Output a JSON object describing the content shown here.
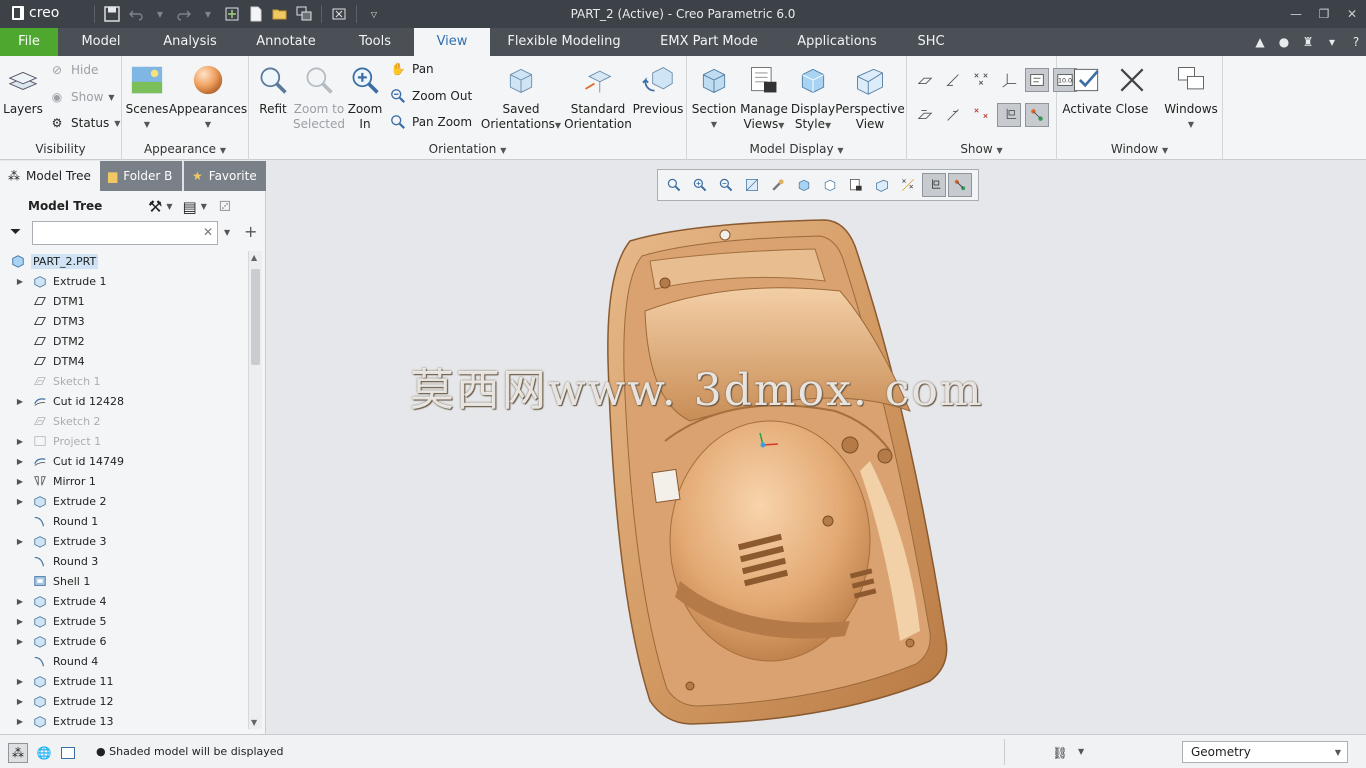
{
  "app": {
    "name": "creo",
    "window_title": "PART_2 (Active) - Creo Parametric 6.0"
  },
  "tabs": [
    "File",
    "Model",
    "Analysis",
    "Annotate",
    "Tools",
    "View",
    "Flexible Modeling",
    "EMX Part Mode",
    "Applications",
    "SHC"
  ],
  "ribbon": {
    "visibility": {
      "layers": "Layers",
      "hide": "Hide",
      "show": "Show",
      "status": "Status",
      "label": "Visibility"
    },
    "appearance": {
      "scenes": "Scenes",
      "appearances": "Appearances",
      "label": "Appearance"
    },
    "orientation": {
      "refit": "Refit",
      "zoom_selected_1": "Zoom to",
      "zoom_selected_2": "Selected",
      "zoom_in_1": "Zoom",
      "zoom_in_2": "In",
      "pan": "Pan",
      "zoom_out": "Zoom Out",
      "pan_zoom": "Pan Zoom",
      "saved_1": "Saved",
      "saved_2": "Orientations",
      "standard_1": "Standard",
      "standard_2": "Orientation",
      "previous": "Previous",
      "label": "Orientation"
    },
    "model_display": {
      "section": "Section",
      "manage_1": "Manage",
      "manage_2": "Views",
      "display_1": "Display",
      "display_2": "Style",
      "persp_1": "Perspective",
      "persp_2": "View",
      "label": "Model Display"
    },
    "show": {
      "label": "Show"
    },
    "window": {
      "activate": "Activate",
      "close": "Close",
      "windows": "Windows",
      "label": "Window"
    }
  },
  "sidebar": {
    "tabs": [
      "Model Tree",
      "Folder B",
      "Favorite"
    ],
    "header": "Model Tree",
    "tree": [
      {
        "label": "PART_2.PRT",
        "icon": "part-icon",
        "expandable": false,
        "suppressed": false,
        "selected": true
      },
      {
        "label": "Extrude 1",
        "icon": "extrude-icon",
        "expandable": true,
        "suppressed": false
      },
      {
        "label": "DTM1",
        "icon": "datum-plane-icon",
        "expandable": false,
        "suppressed": false
      },
      {
        "label": "DTM3",
        "icon": "datum-plane-icon",
        "expandable": false,
        "suppressed": false
      },
      {
        "label": "DTM2",
        "icon": "datum-plane-icon",
        "expandable": false,
        "suppressed": false
      },
      {
        "label": "DTM4",
        "icon": "datum-plane-icon",
        "expandable": false,
        "suppressed": false
      },
      {
        "label": "Sketch 1",
        "icon": "sketch-icon",
        "expandable": false,
        "suppressed": true
      },
      {
        "label": "Cut id 12428",
        "icon": "cut-icon",
        "expandable": true,
        "suppressed": false
      },
      {
        "label": "Sketch 2",
        "icon": "sketch-icon",
        "expandable": false,
        "suppressed": true
      },
      {
        "label": "Project 1",
        "icon": "project-icon",
        "expandable": true,
        "suppressed": true
      },
      {
        "label": "Cut id 14749",
        "icon": "cut-icon",
        "expandable": true,
        "suppressed": false
      },
      {
        "label": "Mirror 1",
        "icon": "mirror-icon",
        "expandable": true,
        "suppressed": false
      },
      {
        "label": "Extrude 2",
        "icon": "extrude-icon",
        "expandable": true,
        "suppressed": false
      },
      {
        "label": "Round 1",
        "icon": "round-icon",
        "expandable": false,
        "suppressed": false
      },
      {
        "label": "Extrude 3",
        "icon": "extrude-icon",
        "expandable": true,
        "suppressed": false
      },
      {
        "label": "Round 3",
        "icon": "round-icon",
        "expandable": false,
        "suppressed": false
      },
      {
        "label": "Shell 1",
        "icon": "shell-icon",
        "expandable": false,
        "suppressed": false
      },
      {
        "label": "Extrude 4",
        "icon": "extrude-icon",
        "expandable": true,
        "suppressed": false
      },
      {
        "label": "Extrude 5",
        "icon": "extrude-icon",
        "expandable": true,
        "suppressed": false
      },
      {
        "label": "Extrude 6",
        "icon": "extrude-icon",
        "expandable": true,
        "suppressed": false
      },
      {
        "label": "Round 4",
        "icon": "round-icon",
        "expandable": false,
        "suppressed": false
      },
      {
        "label": "Extrude 11",
        "icon": "extrude-icon",
        "expandable": true,
        "suppressed": false
      },
      {
        "label": "Extrude 12",
        "icon": "extrude-icon",
        "expandable": true,
        "suppressed": false
      },
      {
        "label": "Extrude 13",
        "icon": "extrude-icon",
        "expandable": true,
        "suppressed": false
      }
    ]
  },
  "viewport": {
    "watermark": "莫西网www. 3dmox. com",
    "model_color": "#d9a574"
  },
  "status": {
    "message": "Shaded model will be displayed",
    "filter_value": "Geometry"
  },
  "colors": {
    "file_tab": "#4ea72e",
    "title_bar": "#3d4248",
    "tab_bar": "#4a5056",
    "accent": "#2f6fb0"
  }
}
